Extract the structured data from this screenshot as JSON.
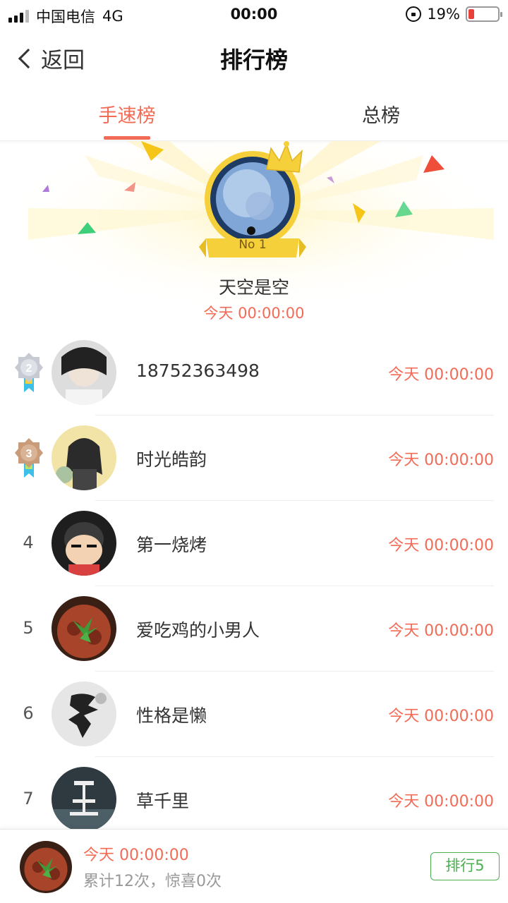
{
  "status_bar": {
    "carrier": "中国电信",
    "network": "4G",
    "time": "00:00",
    "battery_percent": "19%",
    "battery_level": 0.19,
    "battery_color": "#e8413b"
  },
  "nav": {
    "back_label": "返回",
    "title": "排行榜"
  },
  "tabs": [
    {
      "label": "手速榜",
      "active": true
    },
    {
      "label": "总榜",
      "active": false
    }
  ],
  "champion": {
    "badge": "No 1",
    "name": "天空是空",
    "time": "今天 00:00:00"
  },
  "rankings": [
    {
      "rank": "2",
      "name": "18752363498",
      "time": "今天 00:00:00",
      "medal": "silver"
    },
    {
      "rank": "3",
      "name": "时光皓韵",
      "time": "今天 00:00:00",
      "medal": "bronze"
    },
    {
      "rank": "4",
      "name": "第一烧烤",
      "time": "今天 00:00:00"
    },
    {
      "rank": "5",
      "name": "爱吃鸡的小男人",
      "time": "今天 00:00:00"
    },
    {
      "rank": "6",
      "name": "性格是懒",
      "time": "今天 00:00:00"
    },
    {
      "rank": "7",
      "name": "草千里",
      "time": "今天 00:00:00"
    }
  ],
  "me": {
    "time": "今天 00:00:00",
    "stats": "累计12次，惊喜0次",
    "rank_label": "排行5"
  },
  "colors": {
    "accent": "#f26b56",
    "rank_badge": "#4caf50",
    "medal_silver": "#c7c9d3",
    "medal_bronze": "#c99b78",
    "crown": "#f5d03a"
  }
}
